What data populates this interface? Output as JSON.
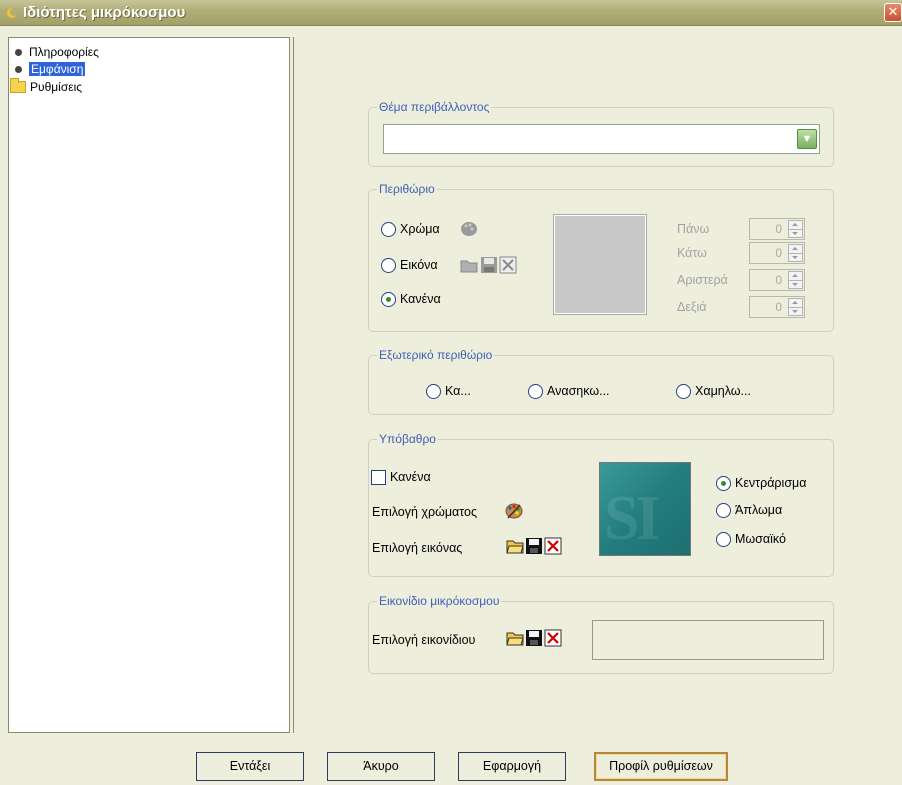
{
  "window": {
    "title": "Ιδιότητες μικρόκοσμου",
    "close_label": "✕"
  },
  "tree": {
    "items": [
      {
        "label": "Πληροφορίες",
        "icon": "bullet-icon",
        "selected": false
      },
      {
        "label": "Εμφάνιση",
        "icon": "bullet-icon",
        "selected": true
      },
      {
        "label": "Ρυθμίσεις",
        "icon": "folder-icon",
        "selected": false
      }
    ]
  },
  "theme": {
    "legend": "Θέμα περιβάλλοντος",
    "value": ""
  },
  "border": {
    "legend": "Περιθώριο",
    "options": [
      "Χρώμα",
      "Εικόνα",
      "Κανένα"
    ],
    "selected": "Κανένα",
    "margins": [
      {
        "label": "Πάνω",
        "value": "0"
      },
      {
        "label": "Κάτω",
        "value": "0"
      },
      {
        "label": "Αριστερά",
        "value": "0"
      },
      {
        "label": "Δεξιά",
        "value": "0"
      }
    ]
  },
  "outer_border": {
    "legend": "Εξωτερικό περιθώριο",
    "options": [
      "Κα...",
      "Ανασηκω...",
      "Χαμηλω..."
    ]
  },
  "background": {
    "legend": "Υπόβαθρο",
    "none_label": "Κανένα",
    "color_label": "Επιλογή χρώματος",
    "image_label": "Επιλογή εικόνας",
    "preview_text": "SI",
    "layout_options": [
      "Κεντράρισμα",
      "Άπλωμα",
      "Μωσαϊκό"
    ],
    "layout_selected": "Κεντράρισμα"
  },
  "icon": {
    "legend": "Εικονίδιο μικρόκοσμου",
    "label": "Επιλογή εικονίδιου"
  },
  "buttons": {
    "ok": "Εντάξει",
    "cancel": "Άκυρο",
    "apply": "Εφαρμογή",
    "profile": "Προφίλ ρυθμίσεων"
  },
  "colors": {
    "titlebar": "#b1ae79",
    "panel": "#eeeedd",
    "legend_text": "#3d5fb8",
    "selection": "#2f64d8"
  }
}
